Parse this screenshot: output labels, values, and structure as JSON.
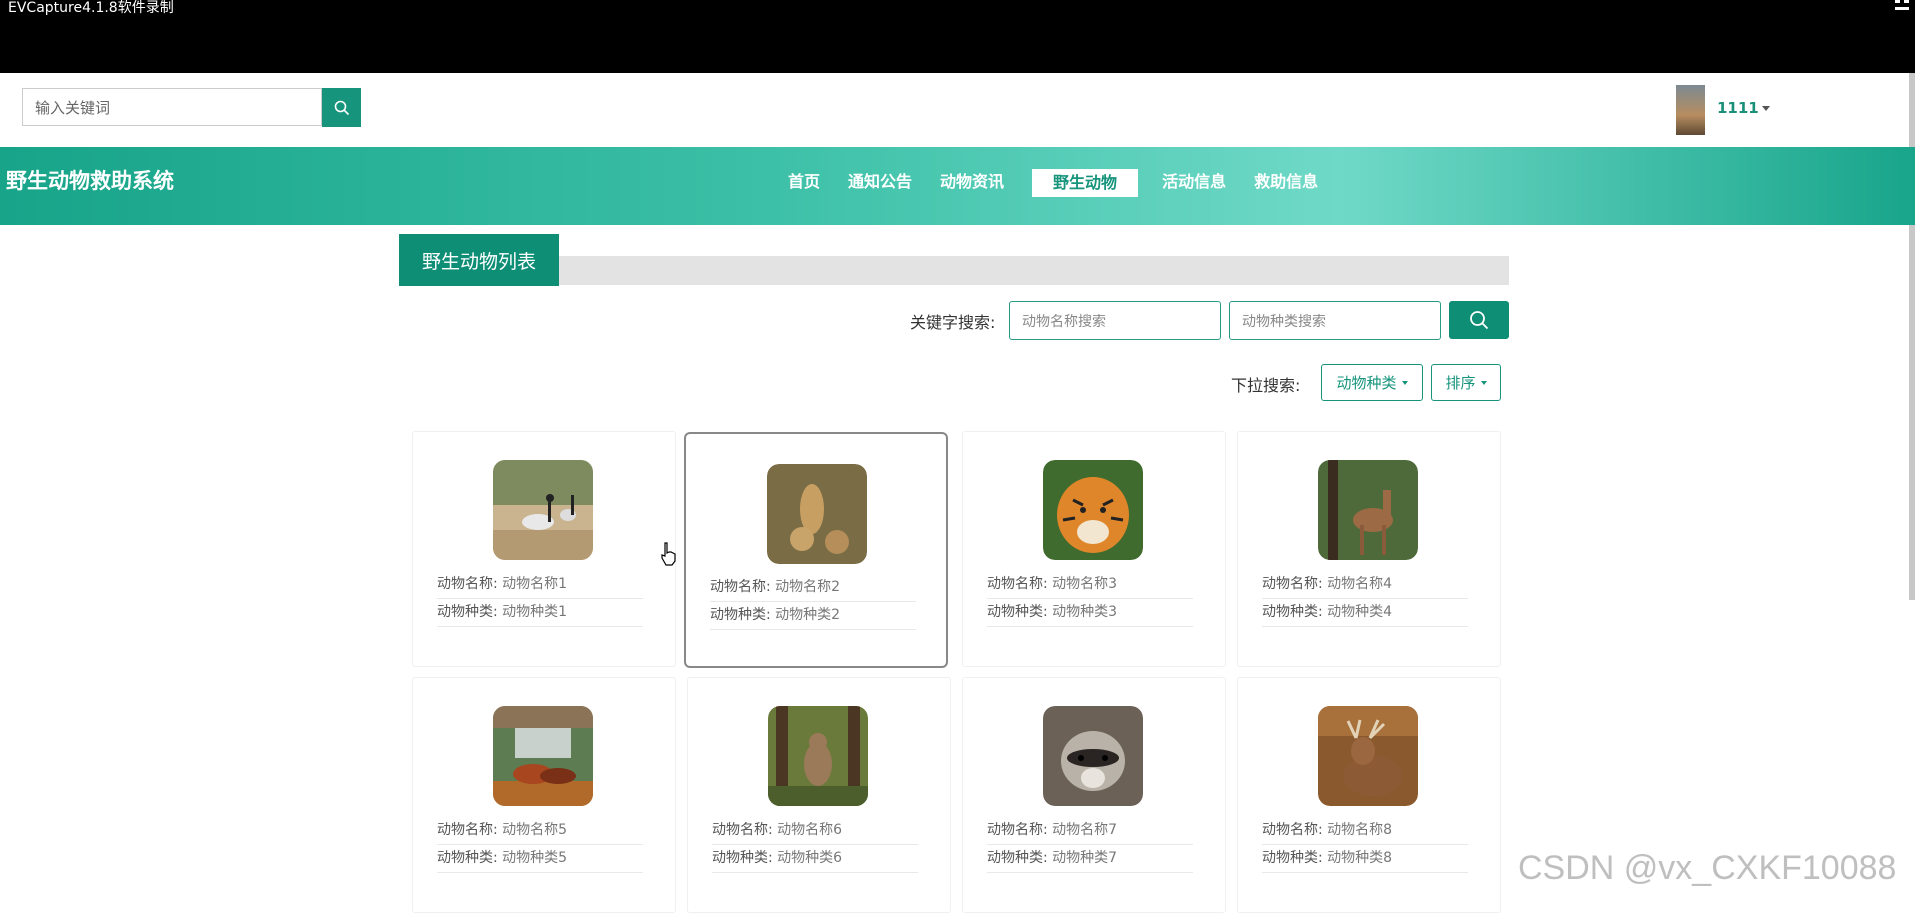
{
  "recorder": {
    "title": "EVCapture4.1.8软件录制"
  },
  "header": {
    "search_placeholder": "输入关键词",
    "user_name": "1111"
  },
  "nav": {
    "site_title": "野生动物救助系统",
    "items": [
      "首页",
      "通知公告",
      "动物资讯",
      "野生动物",
      "活动信息",
      "救助信息"
    ],
    "active": "野生动物"
  },
  "panel": {
    "title": "野生动物列表",
    "keyword_label": "关键字搜索:",
    "name_placeholder": "动物名称搜索",
    "type_placeholder": "动物种类搜索",
    "dropdown_label": "下拉搜索:",
    "dropdown_type": "动物种类",
    "dropdown_sort": "排序"
  },
  "cards": [
    {
      "name_label": "动物名称:",
      "name": "动物名称1",
      "type_label": "动物种类:",
      "type": "动物种类1",
      "image": "cranes"
    },
    {
      "name_label": "动物名称:",
      "name": "动物名称2",
      "type_label": "动物种类:",
      "type": "动物种类2",
      "image": "cheetahs"
    },
    {
      "name_label": "动物名称:",
      "name": "动物名称3",
      "type_label": "动物种类:",
      "type": "动物种类3",
      "image": "tiger"
    },
    {
      "name_label": "动物名称:",
      "name": "动物名称4",
      "type_label": "动物种类:",
      "type": "动物种类4",
      "image": "deer"
    },
    {
      "name_label": "动物名称:",
      "name": "动物名称5",
      "type_label": "动物种类:",
      "type": "动物种类5",
      "image": "red-panda"
    },
    {
      "name_label": "动物名称:",
      "name": "动物名称6",
      "type_label": "动物种类:",
      "type": "动物种类6",
      "image": "squirrel"
    },
    {
      "name_label": "动物名称:",
      "name": "动物名称7",
      "type_label": "动物种类:",
      "type": "动物种类7",
      "image": "raccoon"
    },
    {
      "name_label": "动物名称:",
      "name": "动物名称8",
      "type_label": "动物种类:",
      "type": "动物种类8",
      "image": "stag"
    }
  ],
  "watermark": "CSDN @vx_CXKF10088",
  "colors": {
    "accent": "#0f8e76",
    "nav_gradient_light": "#6fd9c7"
  }
}
